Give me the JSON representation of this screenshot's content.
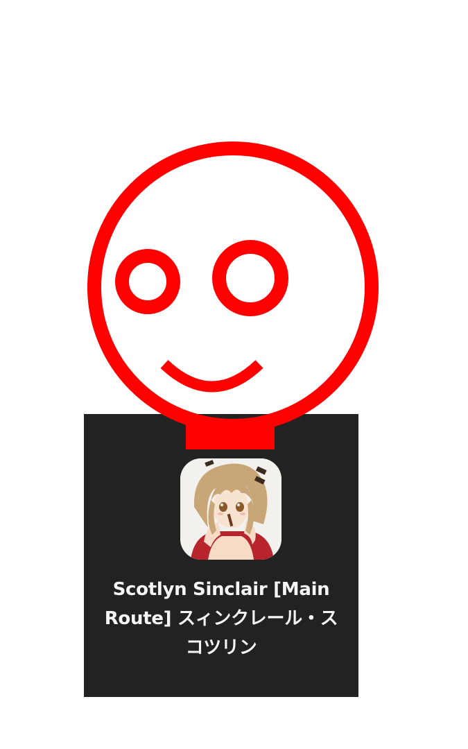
{
  "card": {
    "title": "Scotlyn Sinclair [Main Route] スィンクレール・スコツリン",
    "avatar": "character-portrait"
  },
  "overlay": {
    "icon": "smiley-face-icon",
    "color": "#ff0000"
  },
  "colors": {
    "card_background": "#222222",
    "title_text": "#f5f5f5",
    "page_background": "#ffffff"
  }
}
